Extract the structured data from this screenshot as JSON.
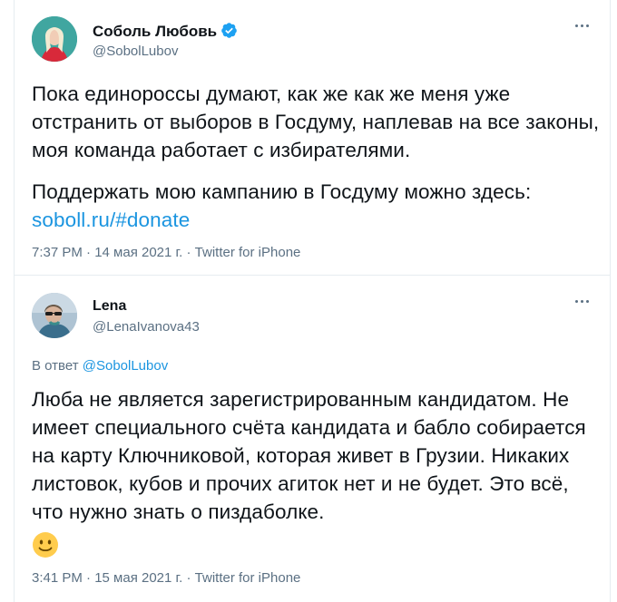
{
  "tweet1": {
    "name": "Соболь Любовь",
    "handle": "@SobolLubov",
    "text": "Пока единороссы думают, как же как же меня уже отстранить от выборов в Госдуму, наплевав на все законы, моя команда работает с избирателями.",
    "text2_prefix": "Поддержать мою кампанию в Госдуму можно здесь:",
    "link": "soboll.ru/#donate",
    "meta": "7:37 PM · 14 мая 2021 г. · Twitter for iPhone"
  },
  "tweet2": {
    "name": "Lena",
    "handle": "@LenaIvanova43",
    "reply_prefix": "В ответ",
    "reply_handle": "@SobolLubov",
    "text": "Люба не является зарегистрированным кандидатом. Не имеет специального счёта кандидата и бабло собирается на карту Ключниковой, которая живет в Грузии. Никаких листовок, кубов и прочих агиток нет и не будет. Это всё, что нужно знать о пиздаболке.",
    "meta": "3:41 PM · 15 мая 2021 г. · Twitter for iPhone"
  },
  "colors": {
    "link": "#1b95e0",
    "secondary_text": "#5b7083",
    "verified_badge": "#1da1f2",
    "divider": "#e6ecf0"
  }
}
